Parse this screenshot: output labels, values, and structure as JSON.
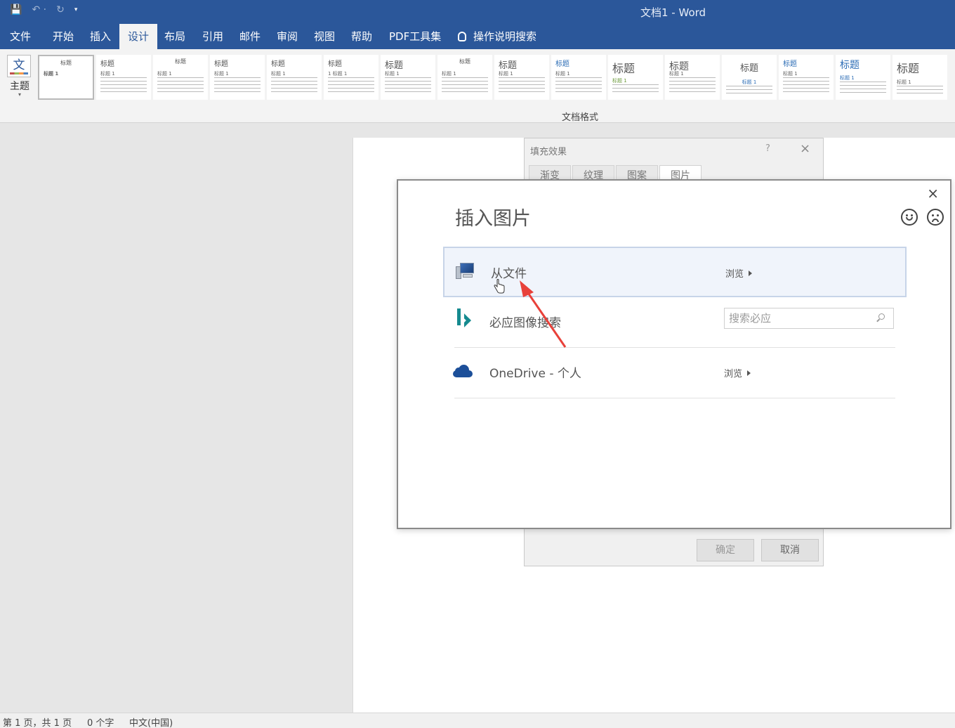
{
  "window": {
    "title": "文档1  -  Word"
  },
  "qat": {
    "save_icon": "save-icon",
    "undo_icon": "undo-icon",
    "redo_icon": "redo-icon",
    "customize_icon": "chevron-down-icon"
  },
  "ribbon_tabs": [
    "文件",
    "开始",
    "插入",
    "设计",
    "布局",
    "引用",
    "邮件",
    "审阅",
    "视图",
    "帮助",
    "PDF工具集"
  ],
  "ribbon_active_tab": "设计",
  "tell_me": "操作说明搜索",
  "ribbon": {
    "theme_icon_text": "文",
    "theme_label": "主题",
    "group_label": "文档格式",
    "style_set": [
      {
        "heading": "标题",
        "sub": "标题 1"
      },
      {
        "heading": "标题",
        "sub": "标题 1"
      },
      {
        "heading": "标题",
        "sub": "标题 1"
      },
      {
        "heading": "标题",
        "sub": "标题 1"
      },
      {
        "heading": "标题",
        "sub": "标题 1"
      },
      {
        "heading": "标题",
        "sub": "1  标题 1"
      },
      {
        "heading": "标题",
        "sub": "标题 1"
      },
      {
        "heading": "标题",
        "sub": "标题 1"
      },
      {
        "heading": "标题",
        "sub": "标题 1"
      },
      {
        "heading": "标题",
        "sub": "标题 1"
      },
      {
        "heading": "标题",
        "sub": "标题 1"
      },
      {
        "heading": "标题",
        "sub": "标题 1"
      },
      {
        "heading": "标题",
        "sub": "标题 1"
      },
      {
        "heading": "标题",
        "sub": "标题 1"
      },
      {
        "heading": "标题",
        "sub": "标题 1"
      },
      {
        "heading": "标题",
        "sub": "标题 1"
      }
    ]
  },
  "fill_dialog": {
    "title": "填充效果",
    "help": "?",
    "tabs": [
      "渐变",
      "纹理",
      "图案",
      "图片"
    ],
    "active_tab": "图片",
    "ok_label": "确定",
    "cancel_label": "取消"
  },
  "insert_dialog": {
    "title": "插入图片",
    "sources": [
      {
        "label": "从文件",
        "action": "浏览",
        "icon": "computer-icon"
      },
      {
        "label": "必应图像搜索",
        "search_placeholder": "搜索必应",
        "icon": "bing-icon"
      },
      {
        "label": "OneDrive - 个人",
        "action": "浏览",
        "icon": "onedrive-icon"
      }
    ]
  },
  "statusbar": {
    "page": "第 1 页，共 1 页",
    "words": "0 个字",
    "language": "中文(中国)"
  },
  "colors": {
    "accent": "#2b579a",
    "annotation_arrow": "#e8413a",
    "bing": "#158a8f",
    "onedrive": "#1c4f99"
  }
}
